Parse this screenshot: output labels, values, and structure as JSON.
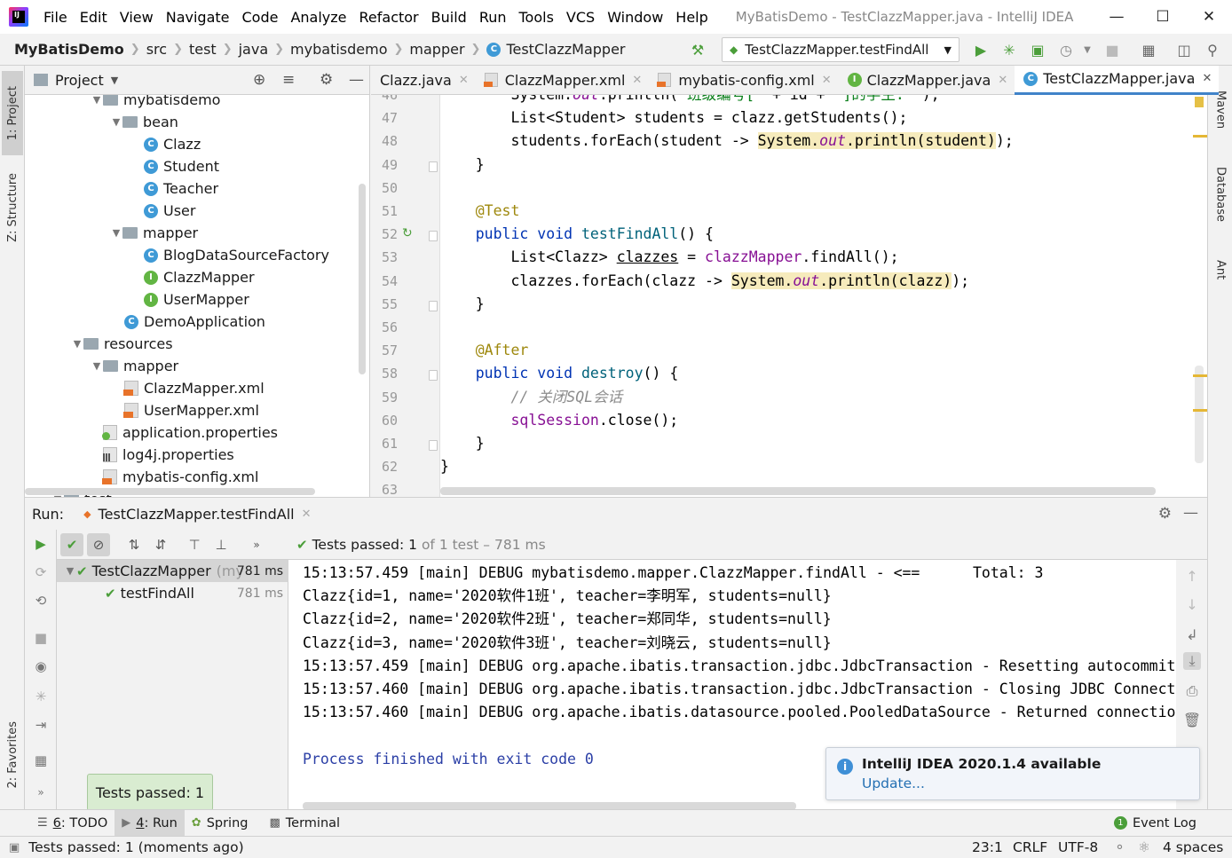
{
  "window": {
    "title": "MyBatisDemo - TestClazzMapper.java - IntelliJ IDEA",
    "menu": [
      "File",
      "Edit",
      "View",
      "Navigate",
      "Code",
      "Analyze",
      "Refactor",
      "Build",
      "Run",
      "Tools",
      "VCS",
      "Window",
      "Help"
    ]
  },
  "breadcrumb": [
    "MyBatisDemo",
    "src",
    "test",
    "java",
    "mybatisdemo",
    "mapper",
    "TestClazzMapper"
  ],
  "run_config": "TestClazzMapper.testFindAll",
  "left_stripe": {
    "project": "1: Project",
    "structure": "Z: Structure",
    "favorites": "2: Favorites"
  },
  "right_stripe": {
    "maven": "Maven",
    "database": "Database",
    "ant": "Ant"
  },
  "project_panel": {
    "title": "Project",
    "tree": [
      {
        "label": "mybatisdemo",
        "type": "folder",
        "indent": 116
      },
      {
        "label": "bean",
        "type": "folder",
        "indent": 138
      },
      {
        "label": "Clazz",
        "type": "class",
        "indent": 162
      },
      {
        "label": "Student",
        "type": "class",
        "indent": 162
      },
      {
        "label": "Teacher",
        "type": "class",
        "indent": 162
      },
      {
        "label": "User",
        "type": "class",
        "indent": 162
      },
      {
        "label": "mapper",
        "type": "folder",
        "indent": 138
      },
      {
        "label": "BlogDataSourceFactory",
        "type": "class",
        "indent": 162
      },
      {
        "label": "ClazzMapper",
        "type": "interface",
        "indent": 162
      },
      {
        "label": "UserMapper",
        "type": "interface",
        "indent": 162
      },
      {
        "label": "DemoApplication",
        "type": "class",
        "indent": 140
      },
      {
        "label": "resources",
        "type": "folder",
        "indent": 94
      },
      {
        "label": "mapper",
        "type": "folder",
        "indent": 116
      },
      {
        "label": "ClazzMapper.xml",
        "type": "xml",
        "indent": 140
      },
      {
        "label": "UserMapper.xml",
        "type": "xml",
        "indent": 140
      },
      {
        "label": "application.properties",
        "type": "prop-green",
        "indent": 116
      },
      {
        "label": "log4j.properties",
        "type": "prop-bars",
        "indent": 116
      },
      {
        "label": "mybatis-config.xml",
        "type": "xml",
        "indent": 116
      },
      {
        "label": "test",
        "type": "folder",
        "indent": 72
      }
    ]
  },
  "editor_tabs": [
    {
      "label": "Clazz.java",
      "icon": "class"
    },
    {
      "label": "ClazzMapper.xml",
      "icon": "xml"
    },
    {
      "label": "mybatis-config.xml",
      "icon": "xml"
    },
    {
      "label": "ClazzMapper.java",
      "icon": "interface"
    },
    {
      "label": "TestClazzMapper.java",
      "icon": "class",
      "active": true
    }
  ],
  "editor": {
    "lines": [
      {
        "n": "46",
        "html": "        System.<span class='st'>out</span>.println(<span class='str'>\"班级编号[\"</span> + id + <span class='str'>\"]的学生: \"</span>);"
      },
      {
        "n": "47",
        "html": "        List&lt;Student&gt; students = clazz.getStudents();"
      },
      {
        "n": "48",
        "html": "        students.forEach(student -&gt; <span class='hl'>System.<span class='st'>out</span>.println(student)</span>);"
      },
      {
        "n": "49",
        "html": "    }"
      },
      {
        "n": "50",
        "html": ""
      },
      {
        "n": "51",
        "html": "    <span class='ann'>@Test</span>"
      },
      {
        "n": "52",
        "html": "    <span class='kw'>public void</span> <span class='fn'>testFindAll</span>() {"
      },
      {
        "n": "53",
        "html": "        List&lt;Clazz&gt; <u>clazzes</u> = <span class='fld'>clazzMapper</span>.findAll();"
      },
      {
        "n": "54",
        "html": "        clazzes.forEach(clazz -&gt; <span class='hl'>System.<span class='st'>out</span>.println(clazz)</span>);"
      },
      {
        "n": "55",
        "html": "    }"
      },
      {
        "n": "56",
        "html": ""
      },
      {
        "n": "57",
        "html": "    <span class='ann'>@After</span>"
      },
      {
        "n": "58",
        "html": "    <span class='kw'>public void</span> <span class='fn'>destroy</span>() {"
      },
      {
        "n": "59",
        "html": "        <span class='cm'>// 关闭SQL会话</span>"
      },
      {
        "n": "60",
        "html": "        <span class='fld'>sqlSession</span>.close();"
      },
      {
        "n": "61",
        "html": "    }"
      },
      {
        "n": "62",
        "html": "}"
      },
      {
        "n": "63",
        "html": ""
      }
    ]
  },
  "run_panel": {
    "label": "Run:",
    "tab": "TestClazzMapper.testFindAll",
    "status_prefix": "Tests passed:",
    "status_count": "1",
    "status_suffix": "of 1 test – 781 ms",
    "tree": [
      {
        "label": "TestClazzMapper",
        "detail": "(my",
        "time": "781 ms"
      },
      {
        "label": "testFindAll",
        "time": "781 ms"
      }
    ],
    "console": [
      "15:13:57.459 [main] DEBUG mybatisdemo.mapper.ClazzMapper.findAll - <==      Total: 3",
      "Clazz{id=1, name='2020软件1班', teacher=李明军, students=null}",
      "Clazz{id=2, name='2020软件2班', teacher=郑同华, students=null}",
      "Clazz{id=3, name='2020软件3班', teacher=刘晓云, students=null}",
      "15:13:57.459 [main] DEBUG org.apache.ibatis.transaction.jdbc.JdbcTransaction - Resetting autocommit",
      "15:13:57.460 [main] DEBUG org.apache.ibatis.transaction.jdbc.JdbcTransaction - Closing JDBC Connect",
      "15:13:57.460 [main] DEBUG org.apache.ibatis.datasource.pooled.PooledDataSource - Returned connectio",
      "",
      "Process finished with exit code 0"
    ]
  },
  "notification": {
    "title": "IntelliJ IDEA 2020.1.4 available",
    "link": "Update..."
  },
  "tooltip": "Tests passed: 1",
  "bottom_tabs": [
    {
      "num": "6",
      "label": ": TODO"
    },
    {
      "num": "4",
      "label": ": Run",
      "active": true
    },
    {
      "num": "",
      "label": "Spring"
    },
    {
      "num": "",
      "label": "Terminal"
    }
  ],
  "event_log": "Event Log",
  "statusbar": {
    "message": "Tests passed: 1 (moments ago)",
    "position": "23:1",
    "line_sep": "CRLF",
    "encoding": "UTF-8",
    "indent": "4 spaces"
  },
  "colors": {
    "accent": "#4083c9",
    "pass": "#4b9e3a",
    "class_icon": "#3f9ad6",
    "interface_icon": "#62b543"
  }
}
